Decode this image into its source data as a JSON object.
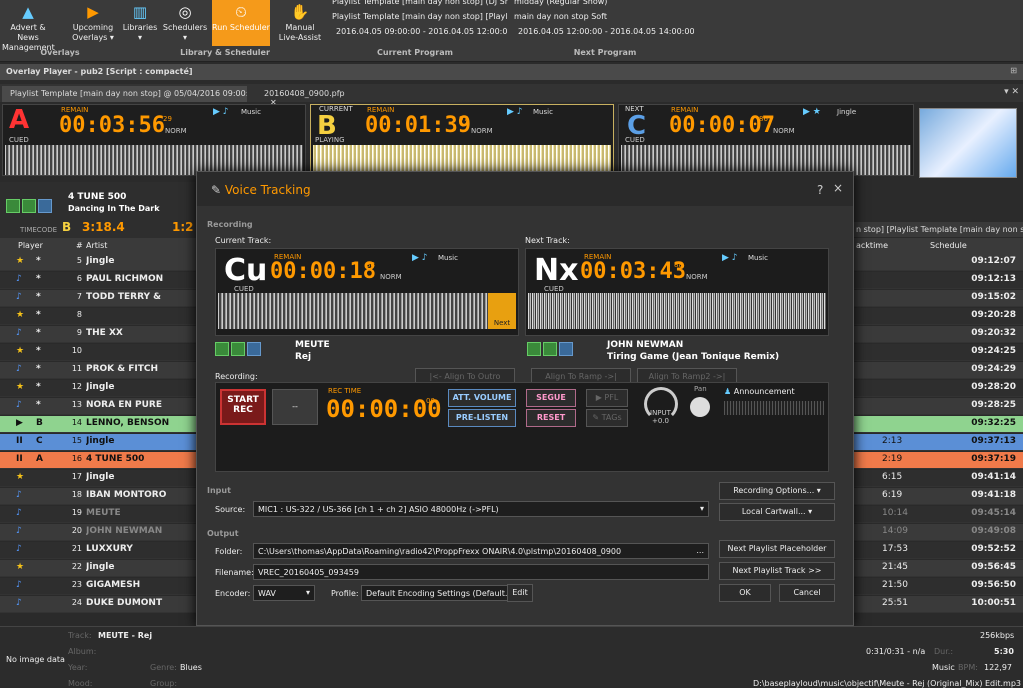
{
  "ribbon": {
    "buttons": [
      {
        "label1": "Advert & News",
        "label2": "Management",
        "icon": "megaphone-icon"
      },
      {
        "label1": "Upcoming",
        "label2": "Overlays ▾",
        "icon": "overlay-icon"
      },
      {
        "label1": "Libraries",
        "label2": "▾",
        "icon": "library-icon"
      },
      {
        "label1": "Schedulers",
        "label2": "▾",
        "icon": "scheduler-icon"
      },
      {
        "label1": "Run Scheduler",
        "label2": "",
        "icon": "run-scheduler-icon"
      },
      {
        "label1": "Manual",
        "label2": "Live-Assist",
        "icon": "live-assist-icon"
      }
    ],
    "groups": [
      "Overlays",
      "Library & Scheduler",
      "Current Program",
      "Next Program"
    ],
    "current_program": [
      "Playlist Template [main day non stop] (DJ Show,",
      "Playlist Template [main day non stop] [Playlist T",
      "2016.04.05 09:00:00 - 2016.04.05 12:00:00"
    ],
    "next_program": [
      "midday (Regular Show)",
      "main day non stop Soft",
      "2016.04.05 12:00:00 - 2016.04.05 14:00:00"
    ]
  },
  "overlay_bar": "Overlay Player - pub2 [Script : compacté]",
  "tabs": [
    "Playlist Template [main day non stop] @ 05/04/2016 09:00:00",
    "20160408_0900.pfp"
  ],
  "decks": [
    {
      "letter": "A",
      "state": "CUED",
      "remain": "REMAIN",
      "time": "00:03:56",
      "frac": "29",
      "norm": "NORM",
      "category": "Music"
    },
    {
      "letter": "B",
      "state": "PLAYING",
      "tag": "CURRENT",
      "remain": "REMAIN",
      "time": "00:01:39",
      "frac": "97",
      "norm": "NORM",
      "category": "Music"
    },
    {
      "letter": "C",
      "state": "CUED",
      "tag": "NEXT",
      "remain": "REMAIN",
      "time": "00:00:07",
      "frac": "86",
      "norm": "NORM",
      "category": "Jingle"
    }
  ],
  "mini_player": {
    "title": "4 TUNE 500",
    "subtitle": "Dancing In The Dark",
    "timecode_label": "TIMECODE",
    "deck": "B",
    "time": "3:18.4",
    "right": "1:2"
  },
  "grid": {
    "headers": [
      "Player",
      "#",
      "Artist",
      "acktime",
      "Schedule"
    ],
    "right_header": "n stop] [Playlist Template [main day non stop]]",
    "rows": [
      {
        "icon": "★",
        "player": "*",
        "n": "5",
        "artist": "Jingle",
        "backtime": "",
        "schedule": "09:12:07",
        "bg": "#3a3a3a"
      },
      {
        "icon": "♪",
        "player": "*",
        "n": "6",
        "artist": "PAUL RICHMON",
        "backtime": "",
        "schedule": "09:12:13",
        "bg": "#2e2e2e"
      },
      {
        "icon": "♪",
        "player": "*",
        "n": "7",
        "artist": "TODD TERRY &",
        "backtime": "",
        "schedule": "09:15:02",
        "bg": "#3a3a3a"
      },
      {
        "icon": "★",
        "player": "*",
        "n": "8",
        "artist": "",
        "backtime": "",
        "schedule": "09:20:28",
        "bg": "#2e2e2e"
      },
      {
        "icon": "♪",
        "player": "*",
        "n": "9",
        "artist": "THE XX",
        "backtime": "",
        "schedule": "09:20:32",
        "bg": "#3a3a3a"
      },
      {
        "icon": "★",
        "player": "*",
        "n": "10",
        "artist": "",
        "backtime": "",
        "schedule": "09:24:25",
        "bg": "#2e2e2e"
      },
      {
        "icon": "♪",
        "player": "*",
        "n": "11",
        "artist": "PROK & FITCH",
        "backtime": "",
        "schedule": "09:24:29",
        "bg": "#3a3a3a"
      },
      {
        "icon": "★",
        "player": "*",
        "n": "12",
        "artist": "Jingle",
        "backtime": "",
        "schedule": "09:28:20",
        "bg": "#2e2e2e"
      },
      {
        "icon": "♪",
        "player": "*",
        "n": "13",
        "artist": "NORA EN PURE",
        "backtime": "",
        "schedule": "09:28:25",
        "bg": "#3a3a3a"
      },
      {
        "icon": "▶",
        "player": "B",
        "n": "14",
        "artist": "LENNO, BENSON",
        "backtime": "",
        "schedule": "09:32:25",
        "bg": "#8fd38f"
      },
      {
        "icon": "II",
        "player": "C",
        "n": "15",
        "artist": "Jingle",
        "backtime": "2:13",
        "schedule": "09:37:13",
        "bg": "#5b8fd6"
      },
      {
        "icon": "II",
        "player": "A",
        "n": "16",
        "artist": "4 TUNE 500",
        "backtime": "2:19",
        "schedule": "09:37:19",
        "bg": "#f07a4a"
      },
      {
        "icon": "★",
        "player": "",
        "n": "17",
        "artist": "Jingle",
        "backtime": "6:15",
        "schedule": "09:41:14",
        "bg": "#2e2e2e"
      },
      {
        "icon": "♪",
        "player": "",
        "n": "18",
        "artist": "IBAN MONTORO",
        "backtime": "6:19",
        "schedule": "09:41:18",
        "bg": "#3a3a3a"
      },
      {
        "icon": "♪",
        "player": "",
        "n": "19",
        "artist": "MEUTE",
        "backtime": "10:14",
        "schedule": "09:45:14",
        "bg": "#2e2e2e",
        "muted": true
      },
      {
        "icon": "♪",
        "player": "",
        "n": "20",
        "artist": "JOHN NEWMAN",
        "backtime": "14:09",
        "schedule": "09:49:08",
        "bg": "#3a3a3a",
        "muted": true
      },
      {
        "icon": "♪",
        "player": "",
        "n": "21",
        "artist": "LUXXURY",
        "backtime": "17:53",
        "schedule": "09:52:52",
        "bg": "#2e2e2e"
      },
      {
        "icon": "★",
        "player": "",
        "n": "22",
        "artist": "Jingle",
        "backtime": "21:45",
        "schedule": "09:56:45",
        "bg": "#3a3a3a"
      },
      {
        "icon": "♪",
        "player": "",
        "n": "23",
        "artist": "GIGAMESH",
        "backtime": "21:50",
        "schedule": "09:56:50",
        "bg": "#2e2e2e"
      },
      {
        "icon": "♪",
        "player": "",
        "n": "24",
        "artist": "DUKE DUMONT",
        "backtime": "25:51",
        "schedule": "10:00:51",
        "bg": "#3a3a3a"
      }
    ]
  },
  "dialog": {
    "title": "Voice Tracking",
    "help": "?",
    "close": "×",
    "recording_section": "Recording",
    "current_track_label": "Current Track:",
    "next_track_label": "Next Track:",
    "cur": {
      "tag": "Cu",
      "state": "CUED",
      "remain": "REMAIN",
      "time": "00:00:18",
      "frac": "88",
      "norm": "NORM",
      "category": "Music",
      "artist": "MEUTE",
      "title": "Rej",
      "marker": "Next"
    },
    "nxt": {
      "tag": "Nx",
      "state": "CUED",
      "remain": "REMAIN",
      "time": "00:03:43",
      "frac": "88",
      "norm": "NORM",
      "category": "Music",
      "artist": "JOHN NEWMAN",
      "title": "Tiring Game (Jean Tonique Remix)"
    },
    "recording_label": "Recording:",
    "align_outro": "|<- Align To Outro",
    "align_ramp": "Align To Ramp ->|",
    "align_ramp2": "Align To Ramp2 ->|",
    "start_rec1": "START",
    "start_rec2": "REC",
    "rec_time_label": "REC TIME",
    "rec_time": "00:00:00",
    "rec_frac": "00",
    "att_volume": "ATT. VOLUME",
    "pre_listen": "PRE-LISTEN",
    "segue": "SEGUE",
    "reset": "RESET",
    "pfl": "PFL",
    "tags": "TAGs",
    "input_label": "INPUT",
    "input_val": "+0.0",
    "pan_label": "Pan",
    "announcement": "Announcement",
    "input_section": "Input",
    "source_label": "Source:",
    "source_value": "MIC1 : US-322 / US-366 [ch 1 + ch 2] ASIO 48000Hz (->PFL)",
    "recording_options": "Recording Options...",
    "local_cartwall": "Local Cartwall...",
    "output_section": "Output",
    "folder_label": "Folder:",
    "folder_value": "C:\\Users\\thomas\\AppData\\Roaming\\radio42\\ProppFrexx ONAIR\\4.0\\plstmp\\20160408_0900",
    "filename_label": "Filename:",
    "filename_value": "VREC_20160405_093459",
    "encoder_label": "Encoder:",
    "encoder_value": "WAV",
    "profile_label": "Profile:",
    "profile_value": "Default Encoding Settings (Default...",
    "edit": "Edit",
    "next_placeholder": "Next Playlist Placeholder >>",
    "next_track_btn": "Next Playlist Track >>",
    "ok": "OK",
    "cancel": "Cancel",
    "browse": "..."
  },
  "status": {
    "no_image": "No image data",
    "track_label": "Track:",
    "track_value": "MEUTE - Rej",
    "album_label": "Album:",
    "year_label": "Year:",
    "genre_label": "Genre:",
    "genre_value": "Blues",
    "mood_label": "Mood:",
    "group_label": "Group:",
    "bitrate": "256kbps",
    "time_pos": "0:31/0:31 - n/a",
    "dur_label": "Dur.:",
    "dur_value": "5:30",
    "type": "Music",
    "bpm_label": "BPM:",
    "bpm_value": "122,97",
    "path": "D:\\baseplayloud\\music\\objectif\\Meute - Rej (Original_Mix) Edit.mp3"
  }
}
